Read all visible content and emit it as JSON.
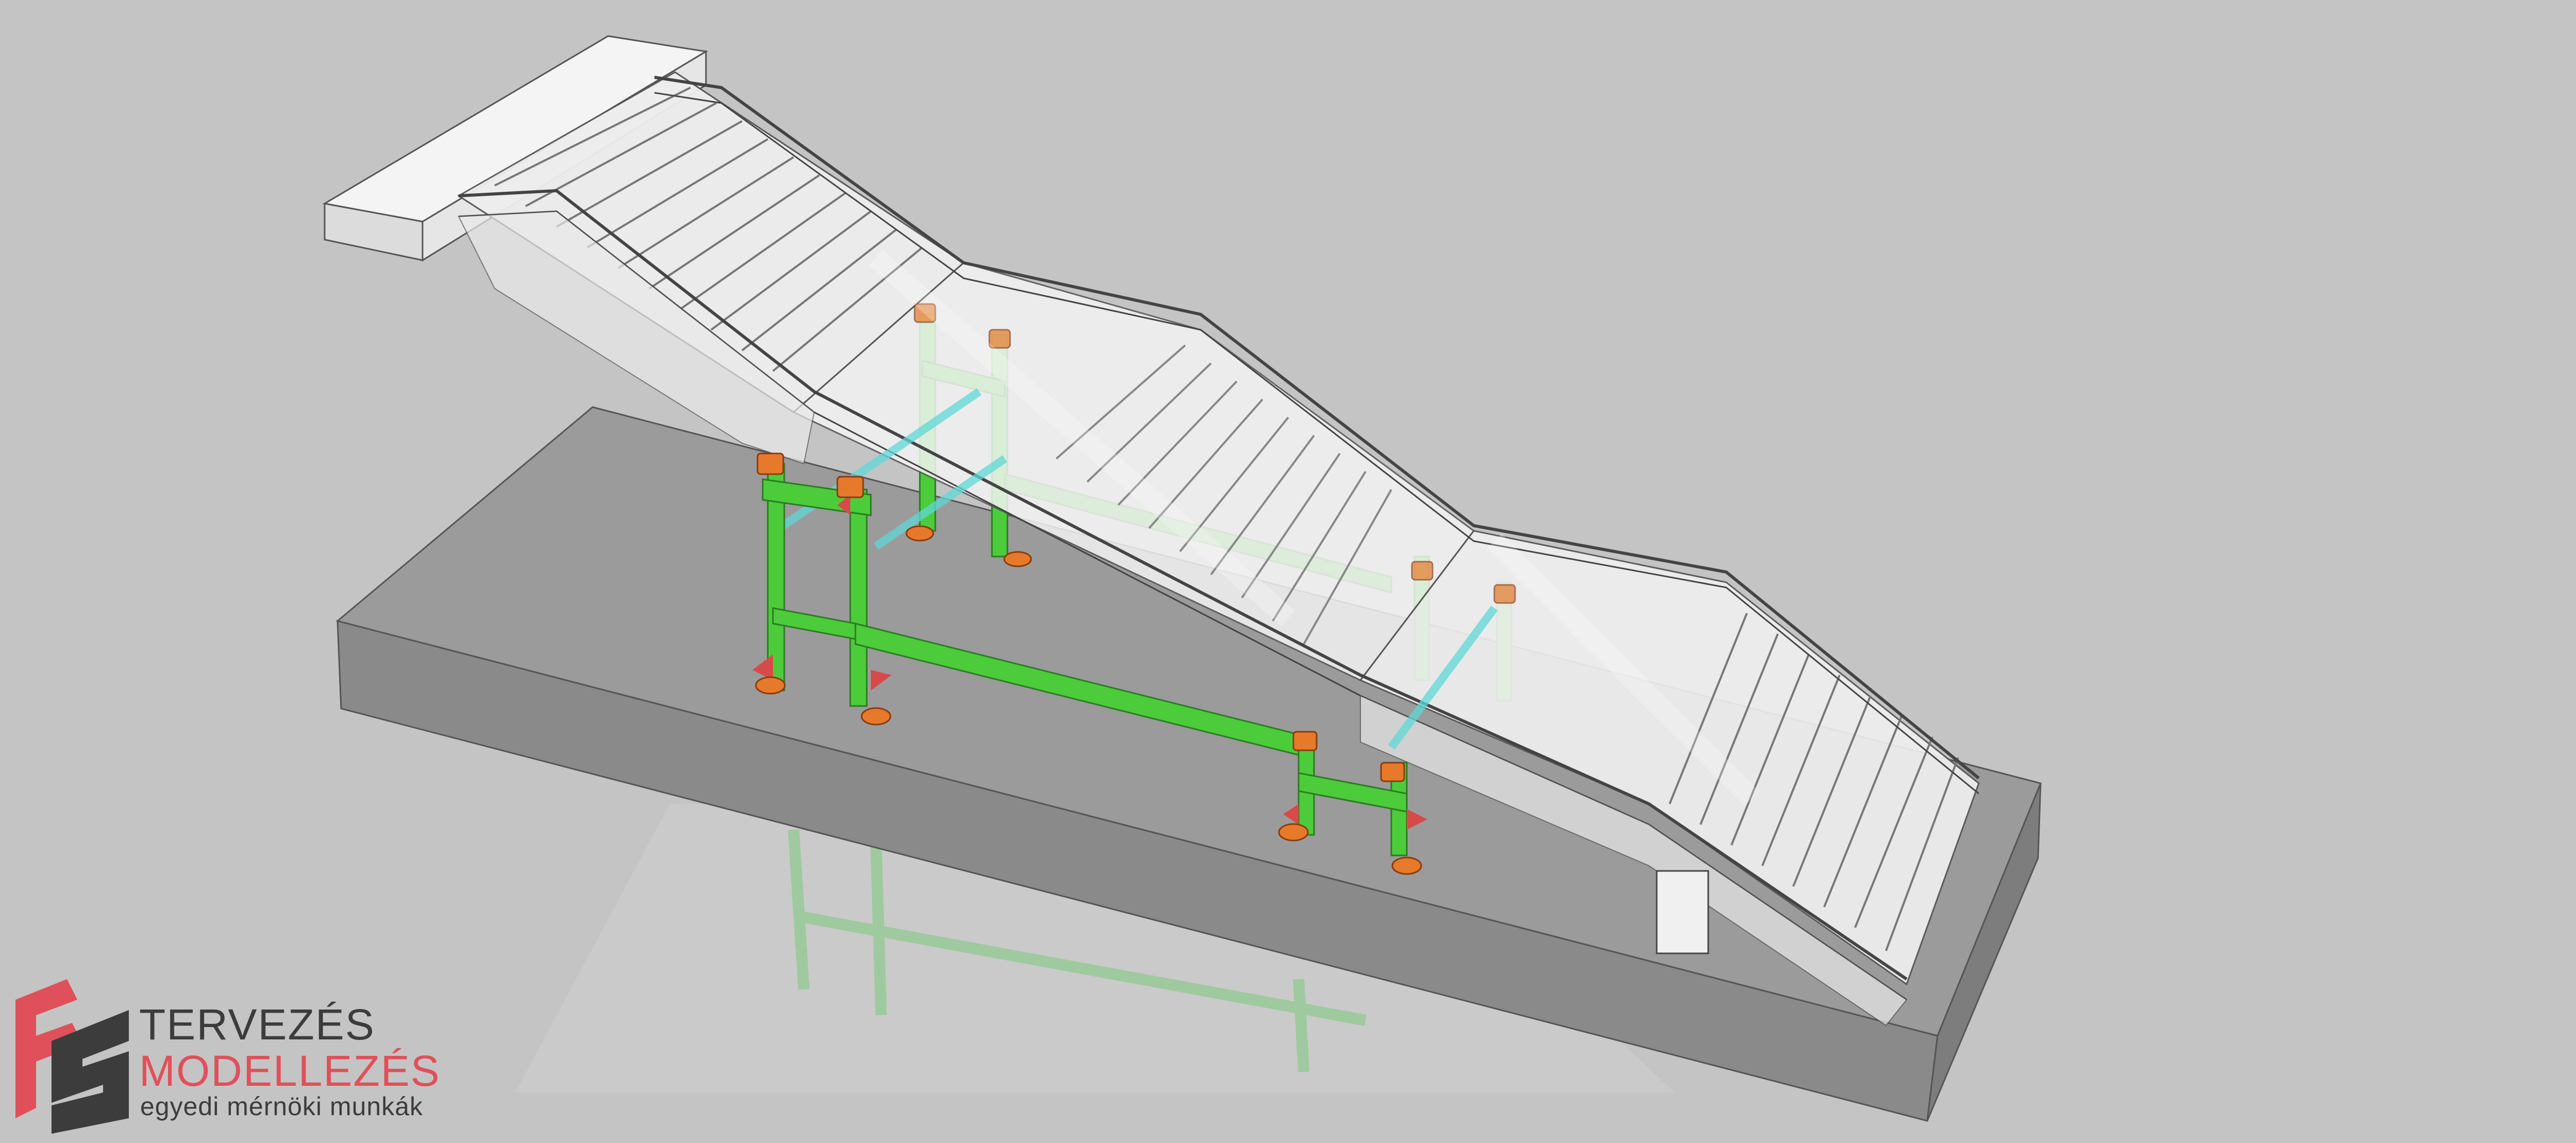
{
  "colors": {
    "background": "#c4c4c4",
    "slab_top": "#9b9b9b",
    "slab_front": "#8a8a8a",
    "stair_white": "#f2f2f2",
    "steel_green": "#4ccc3a",
    "pad_orange": "#e67a2a",
    "gusset_red": "#d84a4a",
    "glass_cyan": "#5fd8d8",
    "brand_dark": "#3c3c3c",
    "brand_red": "#e0505a"
  },
  "logo": {
    "icon": "fm-monogram-icon",
    "line1": "TERVEZÉS",
    "line2": "MODELLEZÉS",
    "line3": "egyedi mérnöki munkák"
  }
}
